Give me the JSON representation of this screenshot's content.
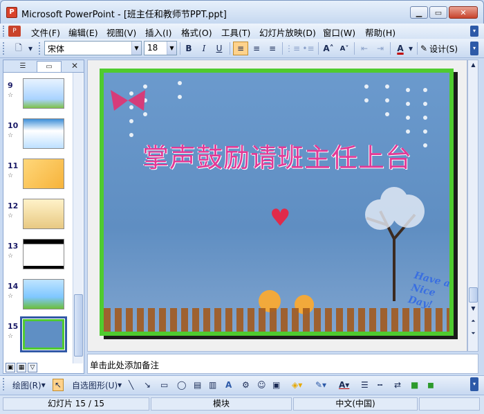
{
  "window": {
    "title": "Microsoft PowerPoint - [班主任和教师节PPT.ppt]"
  },
  "menu": {
    "items": [
      "文件(F)",
      "编辑(E)",
      "视图(V)",
      "插入(I)",
      "格式(O)",
      "工具(T)",
      "幻灯片放映(D)",
      "窗口(W)",
      "帮助(H)"
    ]
  },
  "toolbar": {
    "font_name": "宋体",
    "font_size": "18",
    "design_label": "设计(S)"
  },
  "slides_pane": {
    "numbers": [
      "9",
      "10",
      "11",
      "12",
      "13",
      "14",
      "15"
    ],
    "selected": "15"
  },
  "slide": {
    "title": "掌声鼓励请班主任上台",
    "corner_text": "Have a Nice Day!"
  },
  "notes": {
    "placeholder": "单击此处添加备注"
  },
  "drawing_toolbar": {
    "draw_label": "绘图(R)",
    "autoshapes_label": "自选图形(U)"
  },
  "status": {
    "slide_info": "幻灯片 15 / 15",
    "template": "模块",
    "language": "中文(中国)"
  },
  "colors": {
    "title_pink": "#e23a96",
    "border_green": "#4fcb2f",
    "slide_blue": "#5f8fc4"
  }
}
